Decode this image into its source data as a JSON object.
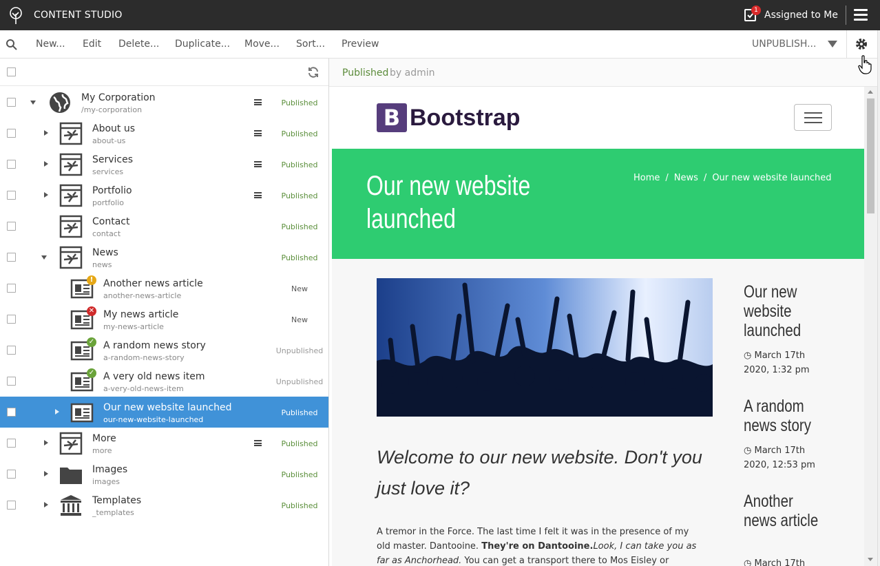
{
  "app": {
    "title": "CONTENT STUDIO",
    "assigned_label": "Assigned to Me",
    "assigned_count": "1"
  },
  "toolbar": {
    "items": [
      "New...",
      "Edit",
      "Delete...",
      "Duplicate...",
      "Move...",
      "Sort...",
      "Preview"
    ],
    "unpublish_label": "UNPUBLISH..."
  },
  "tree": {
    "rows": [
      {
        "name": "My Corporation",
        "path": "/my-corporation",
        "status": "Published",
        "icon": "globe-icon"
      },
      {
        "name": "About us",
        "path": "about-us",
        "status": "Published",
        "icon": "page-icon"
      },
      {
        "name": "Services",
        "path": "services",
        "status": "Published",
        "icon": "page-icon"
      },
      {
        "name": "Portfolio",
        "path": "portfolio",
        "status": "Published",
        "icon": "page-icon"
      },
      {
        "name": "Contact",
        "path": "contact",
        "status": "Published",
        "icon": "page-icon"
      },
      {
        "name": "News",
        "path": "news",
        "status": "Published",
        "icon": "page-icon"
      },
      {
        "name": "Another news article",
        "path": "another-news-article",
        "status": "New",
        "icon": "article-icon",
        "state": "warning"
      },
      {
        "name": "My news article",
        "path": "my-news-article",
        "status": "New",
        "icon": "article-icon",
        "state": "invalid"
      },
      {
        "name": "A random news story",
        "path": "a-random-news-story",
        "status": "Unpublished",
        "icon": "article-icon",
        "state": "ready"
      },
      {
        "name": "A very old news item",
        "path": "a-very-old-news-item",
        "status": "Unpublished",
        "icon": "article-icon",
        "state": "ready"
      },
      {
        "name": "Our new website launched",
        "path": "our-new-website-launched",
        "status": "Published",
        "icon": "article-icon",
        "selected": true
      },
      {
        "name": "More",
        "path": "more",
        "status": "Published",
        "icon": "page-icon"
      },
      {
        "name": "Images",
        "path": "images",
        "status": "Published",
        "icon": "folder-icon"
      },
      {
        "name": "Templates",
        "path": "_templates",
        "status": "Published",
        "icon": "templates-icon"
      }
    ]
  },
  "preview_head": {
    "status": "Published",
    "by": "by admin"
  },
  "site": {
    "brand_letter": "B",
    "brand_name": "Bootstrap",
    "hero_title": "Our new website launched",
    "breadcrumbs": [
      "Home",
      "News",
      "Our new website launched"
    ],
    "lead": "Welcome to our new website. Don't you just love it?",
    "paragraph_start": "A tremor in the Force. The last time I felt it was in the presence of my old master. Dantooine. ",
    "paragraph_bold": "They're on Dantooine.",
    "paragraph_italic": "Look, I can take you as far as Anchorhead.",
    "paragraph_end": " You can get a transport there to Mos Eisley or wherever you're",
    "sidebar": [
      {
        "title": "Our new website launched",
        "date": "March 17th 2020, 1:32 pm"
      },
      {
        "title": "A random news story",
        "date": "March 17th 2020, 12:53 pm"
      },
      {
        "title": "Another news article",
        "date": "March 17th"
      }
    ]
  },
  "colors": {
    "selected": "#4092d8",
    "hero": "#2ecc71",
    "published": "#5a8e3a",
    "appbar": "#2c2c2c"
  }
}
